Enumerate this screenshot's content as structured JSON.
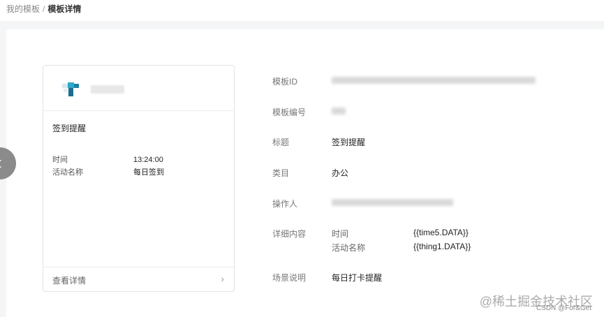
{
  "breadcrumb": {
    "parent": "我的模板",
    "separator": "/",
    "current": "模板详情"
  },
  "card": {
    "title": "签到提醒",
    "fields": [
      {
        "key": "时间",
        "value": "13:24:00"
      },
      {
        "key": "活动名称",
        "value": "每日签到"
      }
    ],
    "footer_label": "查看详情"
  },
  "detail": {
    "template_id_label": "模板ID",
    "template_no_label": "模板编号",
    "title_label": "标题",
    "title_value": "签到提醒",
    "category_label": "类目",
    "category_value": "办公",
    "operator_label": "操作人",
    "content_label": "详细内容",
    "content_rows": [
      {
        "key": "时间",
        "value": "{{time5.DATA}}"
      },
      {
        "key": "活动名称",
        "value": "{{thing1.DATA}}"
      }
    ],
    "scene_label": "场景说明",
    "scene_value": "每日打卡提醒"
  },
  "watermark": {
    "main": "@稀土掘金技术社区",
    "sub": "CSDN @For&Get"
  },
  "icons": {
    "prev": "chevron-left-icon",
    "next": "chevron-right-icon"
  }
}
